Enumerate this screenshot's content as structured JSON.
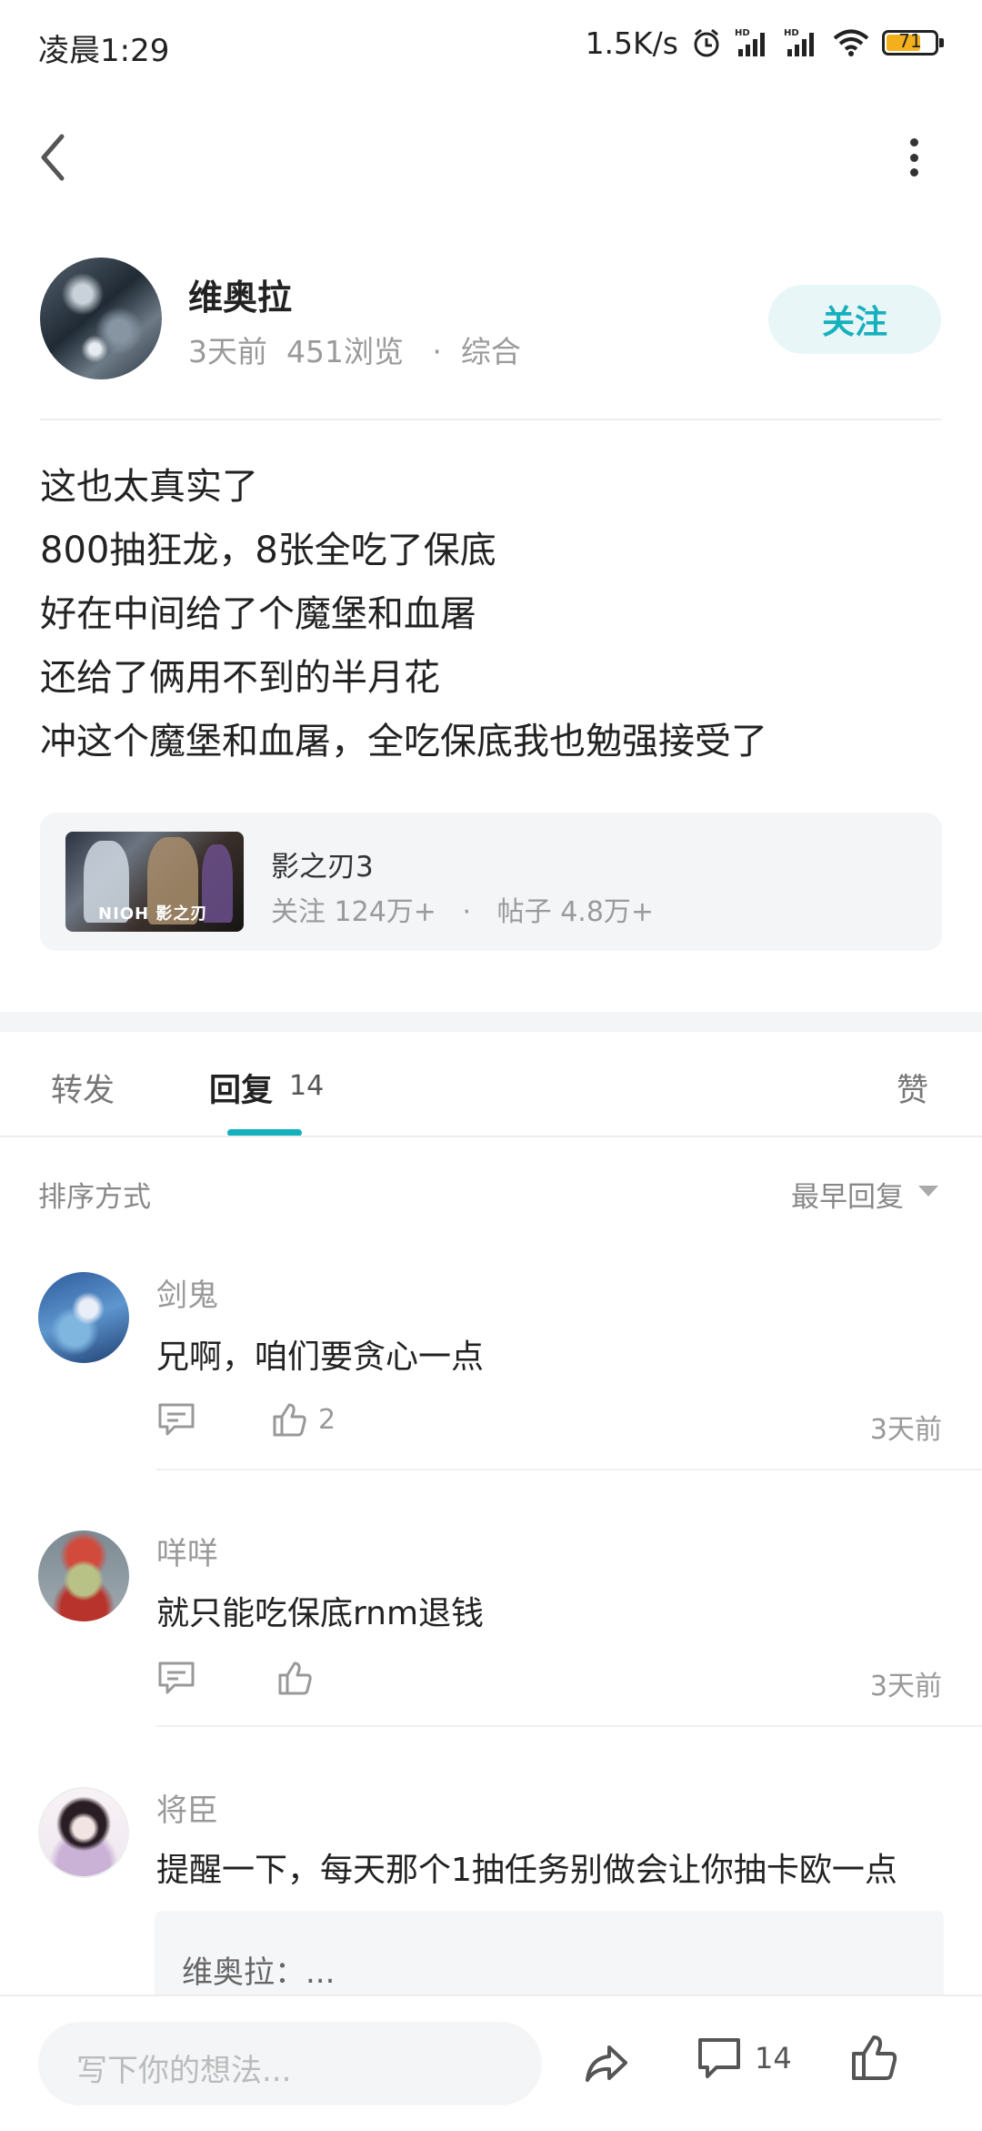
{
  "status_bar": {
    "time": "凌晨1:29",
    "net_speed": "1.5K/s",
    "battery": "71",
    "battery_level": 0.71,
    "icons": [
      "alarm-icon",
      "signal-hd-icon",
      "signal-hd-icon",
      "wifi-icon",
      "battery-icon"
    ]
  },
  "nav": {
    "back_icon": "chevron-left-icon",
    "more_icon": "more-vertical-icon"
  },
  "author": {
    "name": "维奥拉",
    "meta": "3天前  451浏览   ·  综合",
    "follow_label": "关注"
  },
  "post": {
    "lines": [
      "这也太真实了",
      "800抽狂龙，8张全吃了保底",
      "好在中间给了个魔堡和血屠",
      "还给了俩用不到的半月花",
      "冲这个魔堡和血屠，全吃保底我也勉强接受了"
    ]
  },
  "game_card": {
    "title": "影之刃3",
    "stats": "关注 124万+   ·   帖子 4.8万+",
    "thumb_logo": "NIOH 影之刃"
  },
  "tabs": {
    "forward": "转发",
    "reply": "回复",
    "reply_count": "14",
    "like": "赞"
  },
  "sort": {
    "label": "排序方式",
    "value": "最早回复"
  },
  "comments": [
    {
      "name": "剑鬼",
      "text": "兄啊，咱们要贪心一点",
      "likes": "2",
      "time": "3天前"
    },
    {
      "name": "咩咩",
      "text": "就只能吃保底rnm退钱",
      "likes": "",
      "time": "3天前"
    },
    {
      "name": "将臣",
      "text": "提醒一下，每天那个1抽任务别做会让你抽卡欧一点",
      "quote": "维奥拉：..."
    }
  ],
  "bottom_bar": {
    "placeholder": "写下你的想法...",
    "comment_count": "14"
  },
  "colors": {
    "accent": "#15b0be",
    "follow_bg": "#e8f6f7",
    "card_bg": "#f3f5f7"
  }
}
